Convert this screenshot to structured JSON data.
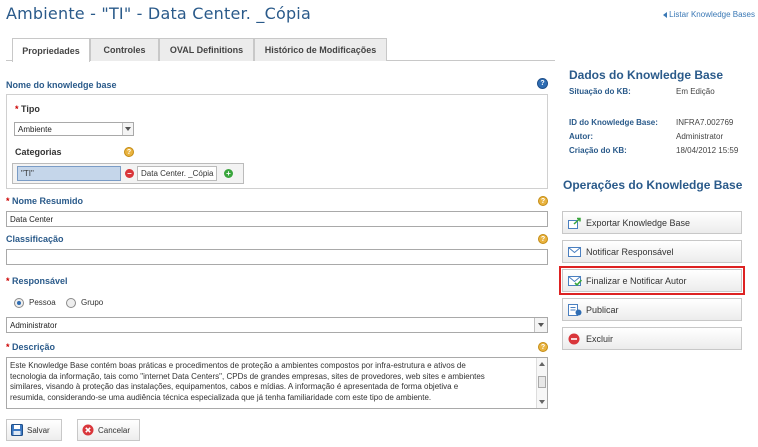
{
  "header": {
    "title": "Ambiente - \"TI\" - Data Center. _Cópia",
    "back_link": "Listar Knowledge Bases"
  },
  "tabs": [
    {
      "label": "Propriedades",
      "active": true
    },
    {
      "label": "Controles",
      "active": false
    },
    {
      "label": "OVAL Definitions",
      "active": false
    },
    {
      "label": "Histórico de Modificações",
      "active": false
    }
  ],
  "form": {
    "kb_name_label": "Nome do knowledge base",
    "type_label": "Tipo",
    "type_value": "Ambiente",
    "categories_label": "Categorias",
    "categories": [
      "\"TI\"",
      "Data Center. _Cópia"
    ],
    "short_name_label": "Nome Resumido",
    "short_name_value": "Data Center",
    "classification_label": "Classificação",
    "classification_value": "",
    "responsible_label": "Responsável",
    "responsible_options": [
      "Pessoa",
      "Grupo"
    ],
    "responsible_selected": "Pessoa",
    "responsible_value": "Administrator",
    "description_label": "Descrição",
    "description_lines": [
      "Este Knowledge Base contém boas práticas e procedimentos de proteção a ambientes compostos por infra-estrutura e ativos de",
      "tecnologia da informação, tais como \"internet Data Centers\", CPDs de grandes empresas, sites de provedores, web sites e ambientes",
      "similares, visando à proteção das instalações, equipamentos, cabos e mídias. A informação é apresentada de forma objetiva e",
      "resumida, considerando-se uma audiência técnica especializada que já tenha familiaridade com este tipo de ambiente."
    ],
    "save_label": "Salvar",
    "cancel_label": "Cancelar"
  },
  "kb_data": {
    "title": "Dados do Knowledge Base",
    "status_label": "Situação do KB:",
    "status_value": "Em Edição",
    "id_label": "ID do Knowledge Base:",
    "id_value": "INFRA7.002769",
    "author_label": "Autor:",
    "author_value": "Administrator",
    "created_label": "Criação do KB:",
    "created_value": "18/04/2012 15:59"
  },
  "operations": {
    "title": "Operações do Knowledge Base",
    "items": [
      {
        "label": "Exportar Knowledge Base",
        "icon": "export-icon",
        "highlighted": false
      },
      {
        "label": "Notificar Responsável",
        "icon": "envelope-icon",
        "highlighted": false
      },
      {
        "label": "Finalizar e Notificar Autor",
        "icon": "envelope-check-icon",
        "highlighted": true
      },
      {
        "label": "Publicar",
        "icon": "publish-icon",
        "highlighted": false
      },
      {
        "label": "Excluir",
        "icon": "delete-icon",
        "highlighted": false
      }
    ]
  },
  "colors": {
    "title": "#2a5a8a",
    "highlight": "#dd2222",
    "required": "#cc0000"
  }
}
